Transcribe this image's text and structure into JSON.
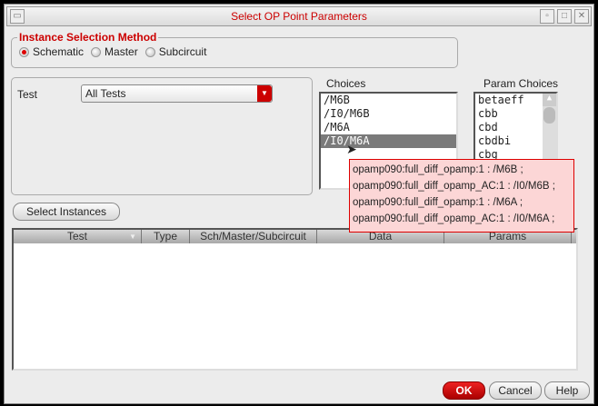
{
  "window": {
    "title": "Select OP Point Parameters"
  },
  "instance_selection": {
    "legend": "Instance Selection Method",
    "options": [
      {
        "label": "Schematic",
        "selected": true
      },
      {
        "label": "Master",
        "selected": false
      },
      {
        "label": "Subcircuit",
        "selected": false
      }
    ]
  },
  "test": {
    "label": "Test",
    "value": "All Tests"
  },
  "choices": {
    "label": "Choices",
    "items": [
      "/M6B",
      "/I0/M6B",
      "/M6A",
      "/I0/M6A"
    ],
    "selected": "/I0/M6A"
  },
  "param_choices": {
    "label": "Param Choices",
    "items": [
      "betaeff",
      "cbb",
      "cbd",
      "cbdbi",
      "cbg"
    ]
  },
  "tooltip": {
    "lines": [
      "opamp090:full_diff_opamp:1 : /M6B ;",
      "opamp090:full_diff_opamp_AC:1 : /I0/M6B ;",
      "opamp090:full_diff_opamp:1 : /M6A ;",
      "opamp090:full_diff_opamp_AC:1 : /I0/M6A ;"
    ]
  },
  "select_instances_label": "Select Instances",
  "table": {
    "columns": [
      "Test",
      "Type",
      "Sch/Master/Subcircuit",
      "Data",
      "Params"
    ]
  },
  "buttons": {
    "ok": "OK",
    "cancel": "Cancel",
    "help": "Help"
  }
}
